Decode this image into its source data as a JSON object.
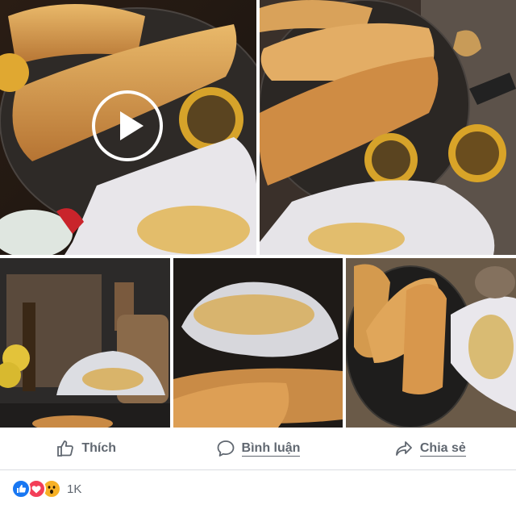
{
  "post": {
    "actions": {
      "like_label": "Thích",
      "comment_label": "Bình luận",
      "share_label": "Chia sẻ"
    },
    "reactions": {
      "icons": [
        "like-icon",
        "love-icon",
        "wow-icon"
      ],
      "count": "1K"
    }
  },
  "colors": {
    "action_text": "#606770",
    "like_blue": "#1877f2",
    "love_red": "#f33e58",
    "wow_yellow": "#f7b125",
    "divider": "#dadde1"
  }
}
